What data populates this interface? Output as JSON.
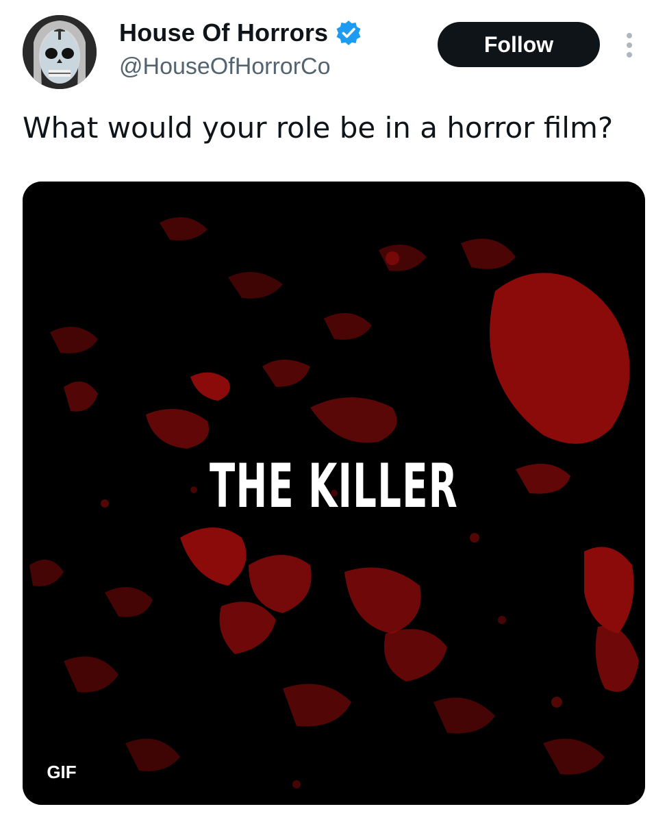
{
  "account": {
    "display_name": "House Of Horrors",
    "handle": "@HouseOfHorrorCo",
    "verified_icon": "verified-badge-icon",
    "avatar_icon": "avatar-image"
  },
  "actions": {
    "follow_label": "Follow",
    "more_icon": "more-options-icon"
  },
  "post": {
    "text": "What would your role be in a horror film?",
    "media": {
      "overlay_text": "THE KILLER",
      "badge": "GIF"
    }
  },
  "colors": {
    "accent": "#1d9bf0",
    "button_bg": "#0f1419",
    "blood_red": "#8b0a0a",
    "media_bg": "#000000",
    "secondary_text": "#536471"
  }
}
